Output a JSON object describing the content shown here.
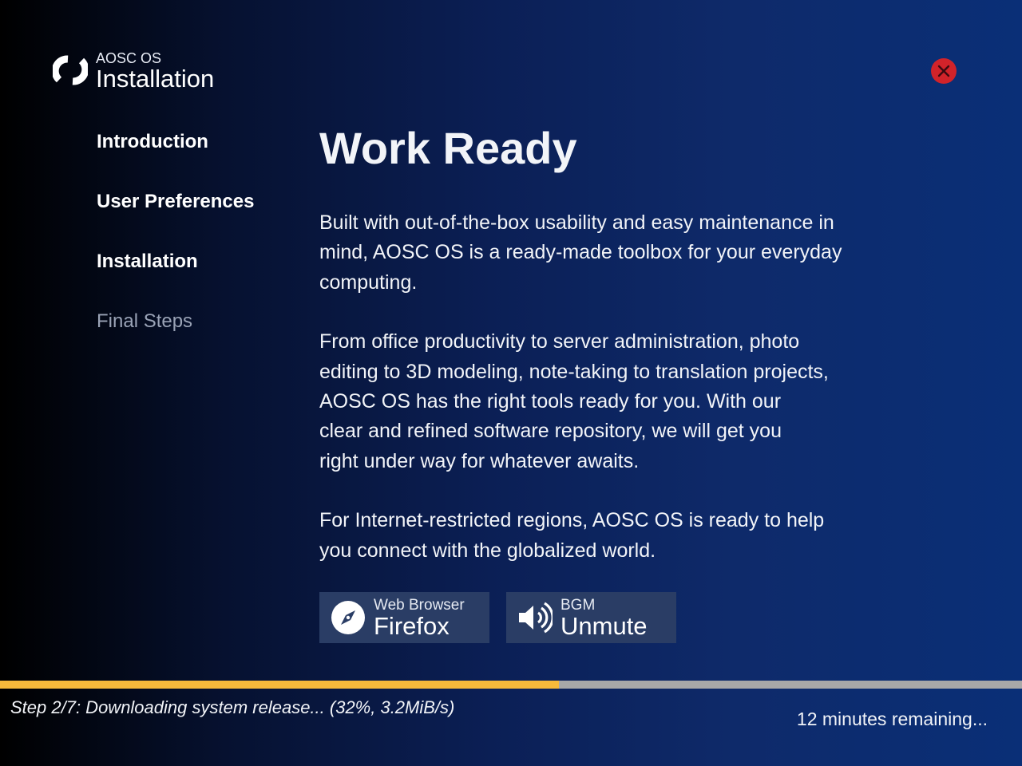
{
  "header": {
    "subtitle": "AOSC OS",
    "title": "Installation",
    "logo_icon": "aosc-logo-icon",
    "close_icon": "close-icon",
    "close_color": "#d1232a"
  },
  "sidebar": {
    "items": [
      {
        "label": "Introduction",
        "state": "complete"
      },
      {
        "label": "User Preferences",
        "state": "complete"
      },
      {
        "label": "Installation",
        "state": "current"
      },
      {
        "label": "Final Steps",
        "state": "pending"
      }
    ]
  },
  "main": {
    "title": "Work Ready",
    "paragraphs": [
      "Built with out-of-the-box usability and easy maintenance in\nmind, AOSC OS is a ready-made toolbox for your everyday\ncomputing.",
      "From office productivity to server administration, photo\nediting to 3D modeling, note-taking to translation projects,\nAOSC OS has the right tools ready for you. With our\nclear and refined software repository, we will get you\nright under way for whatever awaits.",
      "For Internet-restricted regions, AOSC OS is ready to help\nyou connect with the globalized world."
    ]
  },
  "actions": {
    "browser": {
      "sub": "Web Browser",
      "label": "Firefox",
      "icon": "compass-icon"
    },
    "bgm": {
      "sub": "BGM",
      "label": "Unmute",
      "icon": "speaker-icon"
    }
  },
  "progress": {
    "fraction": 0.547,
    "fill_color": "#f6b93b",
    "track_color": "#a8a8a8"
  },
  "status": {
    "text": "Step 2/7: Downloading system release... (32%, 3.2MiB/s)",
    "remaining": "12 minutes remaining..."
  }
}
